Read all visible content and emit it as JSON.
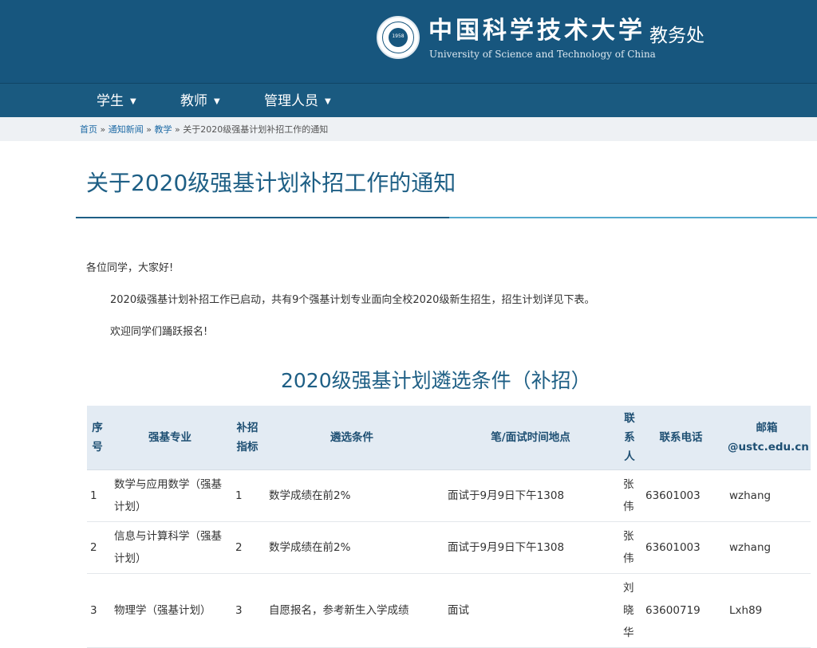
{
  "header": {
    "school_cn": "中国科学技术大学",
    "department": "教务处",
    "school_en": "University of Science and Technology of China",
    "seal_year": "1958"
  },
  "nav": {
    "items": [
      {
        "label": "学生"
      },
      {
        "label": "教师"
      },
      {
        "label": "管理人员"
      }
    ]
  },
  "breadcrumb": {
    "home": "首页",
    "sep": "»",
    "news": "通知新闻",
    "category": "教学",
    "current": "关于2020级强基计划补招工作的通知"
  },
  "article": {
    "title": "关于2020级强基计划补招工作的通知",
    "greeting": "各位同学，大家好!",
    "para1": "2020级强基计划补招工作已启动，共有9个强基计划专业面向全校2020级新生招生，招生计划详见下表。",
    "para2": "欢迎同学们踊跃报名!",
    "table_title": "2020级强基计划遴选条件（补招）"
  },
  "table": {
    "headers": [
      "序号",
      "强基专业",
      "补招指标",
      "遴选条件",
      "笔/面试时间地点",
      "联系人",
      "联系电话",
      "邮箱@ustc.edu.cn"
    ],
    "rows": [
      [
        "1",
        "数学与应用数学（强基计划）",
        "1",
        "数学成绩在前2%",
        "面试于9月9日下午1308",
        "张伟",
        "63601003",
        "wzhang"
      ],
      [
        "2",
        "信息与计算科学（强基计划）",
        "2",
        "数学成绩在前2%",
        "面试于9月9日下午1308",
        "张伟",
        "63601003",
        "wzhang"
      ],
      [
        "3",
        "物理学（强基计划）",
        "3",
        "自愿报名，参考新生入学成绩",
        "面试",
        "刘晓华",
        "63600719",
        "Lxh89"
      ]
    ]
  },
  "colors": {
    "header_bg": "#17567e",
    "nav_bg": "#1a5a80",
    "title": "#1e5f85",
    "table_header_bg": "#e3ebf3"
  }
}
